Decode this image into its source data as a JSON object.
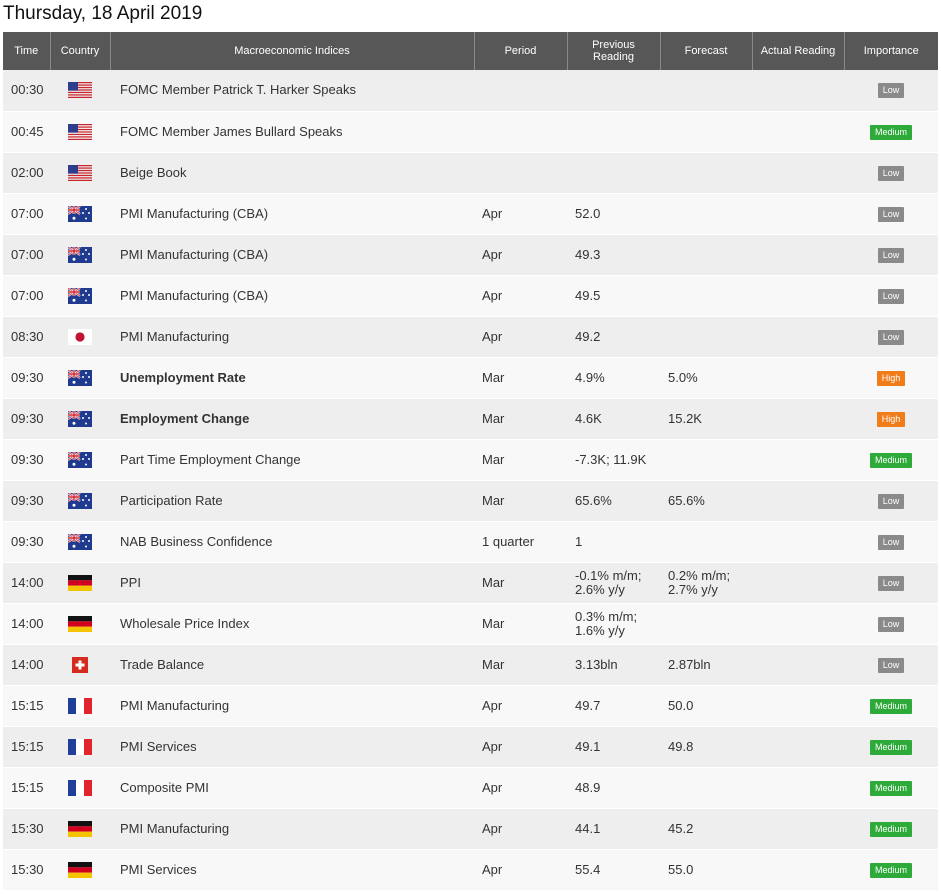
{
  "page_title": "Thursday, 18 April 2019",
  "columns": {
    "time": "Time",
    "country": "Country",
    "indices": "Macroeconomic Indices",
    "period": "Period",
    "previous": "Previous\nReading",
    "forecast": "Forecast",
    "actual": "Actual Reading",
    "importance": "Importance"
  },
  "importance_colors": {
    "Low": "#8a8a8a",
    "Medium": "#2eaa3a",
    "High": "#f07c1a"
  },
  "rows": [
    {
      "time": "00:30",
      "country": "us-flag-icon",
      "name": "FOMC Member Patrick T. Harker Speaks",
      "bold": false,
      "period": "",
      "previous": "",
      "forecast": "",
      "actual": "",
      "importance": "Low"
    },
    {
      "time": "00:45",
      "country": "us-flag-icon",
      "name": "FOMC Member James Bullard Speaks",
      "bold": false,
      "period": "",
      "previous": "",
      "forecast": "",
      "actual": "",
      "importance": "Medium"
    },
    {
      "time": "02:00",
      "country": "us-flag-icon",
      "name": "Beige Book",
      "bold": false,
      "period": "",
      "previous": "",
      "forecast": "",
      "actual": "",
      "importance": "Low"
    },
    {
      "time": "07:00",
      "country": "australia-flag-icon",
      "name": "PMI Manufacturing (CBA)",
      "bold": false,
      "period": "Apr",
      "previous": "52.0",
      "forecast": "",
      "actual": "",
      "importance": "Low"
    },
    {
      "time": "07:00",
      "country": "australia-flag-icon",
      "name": "PMI Manufacturing (CBA)",
      "bold": false,
      "period": "Apr",
      "previous": "49.3",
      "forecast": "",
      "actual": "",
      "importance": "Low"
    },
    {
      "time": "07:00",
      "country": "australia-flag-icon",
      "name": "PMI Manufacturing (CBA)",
      "bold": false,
      "period": "Apr",
      "previous": "49.5",
      "forecast": "",
      "actual": "",
      "importance": "Low"
    },
    {
      "time": "08:30",
      "country": "japan-flag-icon",
      "name": "PMI Manufacturing",
      "bold": false,
      "period": "Apr",
      "previous": "49.2",
      "forecast": "",
      "actual": "",
      "importance": "Low"
    },
    {
      "time": "09:30",
      "country": "australia-flag-icon",
      "name": "Unemployment Rate",
      "bold": true,
      "period": "Mar",
      "previous": "4.9%",
      "forecast": "5.0%",
      "actual": "",
      "importance": "High"
    },
    {
      "time": "09:30",
      "country": "australia-flag-icon",
      "name": "Employment Change",
      "bold": true,
      "period": "Mar",
      "previous": "4.6K",
      "forecast": "15.2K",
      "actual": "",
      "importance": "High"
    },
    {
      "time": "09:30",
      "country": "australia-flag-icon",
      "name": "Part Time Employment Change",
      "bold": false,
      "period": "Mar",
      "previous": "-7.3K; 11.9K",
      "forecast": "",
      "actual": "",
      "importance": "Medium"
    },
    {
      "time": "09:30",
      "country": "australia-flag-icon",
      "name": "Participation Rate",
      "bold": false,
      "period": "Mar",
      "previous": "65.6%",
      "forecast": "65.6%",
      "actual": "",
      "importance": "Low"
    },
    {
      "time": "09:30",
      "country": "australia-flag-icon",
      "name": "NAB Business Confidence",
      "bold": false,
      "period": "1 quarter",
      "previous": "1",
      "forecast": "",
      "actual": "",
      "importance": "Low"
    },
    {
      "time": "14:00",
      "country": "germany-flag-icon",
      "name": "PPI",
      "bold": false,
      "period": "Mar",
      "previous": "-0.1% m/m;\n2.6% y/y",
      "forecast": "0.2% m/m;\n2.7% y/y",
      "actual": "",
      "importance": "Low"
    },
    {
      "time": "14:00",
      "country": "germany-flag-icon",
      "name": "Wholesale Price Index",
      "bold": false,
      "period": "Mar",
      "previous": "0.3% m/m;\n1.6% y/y",
      "forecast": "",
      "actual": "",
      "importance": "Low"
    },
    {
      "time": "14:00",
      "country": "switzerland-flag-icon",
      "name": "Trade Balance",
      "bold": false,
      "period": "Mar",
      "previous": "3.13bln",
      "forecast": "2.87bln",
      "actual": "",
      "importance": "Low"
    },
    {
      "time": "15:15",
      "country": "france-flag-icon",
      "name": "PMI Manufacturing",
      "bold": false,
      "period": "Apr",
      "previous": "49.7",
      "forecast": "50.0",
      "actual": "",
      "importance": "Medium"
    },
    {
      "time": "15:15",
      "country": "france-flag-icon",
      "name": "PMI Services",
      "bold": false,
      "period": "Apr",
      "previous": "49.1",
      "forecast": "49.8",
      "actual": "",
      "importance": "Medium"
    },
    {
      "time": "15:15",
      "country": "france-flag-icon",
      "name": "Composite PMI",
      "bold": false,
      "period": "Apr",
      "previous": "48.9",
      "forecast": "",
      "actual": "",
      "importance": "Medium"
    },
    {
      "time": "15:30",
      "country": "germany-flag-icon",
      "name": "PMI Manufacturing",
      "bold": false,
      "period": "Apr",
      "previous": "44.1",
      "forecast": "45.2",
      "actual": "",
      "importance": "Medium"
    },
    {
      "time": "15:30",
      "country": "germany-flag-icon",
      "name": "PMI Services",
      "bold": false,
      "period": "Apr",
      "previous": "55.4",
      "forecast": "55.0",
      "actual": "",
      "importance": "Medium"
    }
  ]
}
